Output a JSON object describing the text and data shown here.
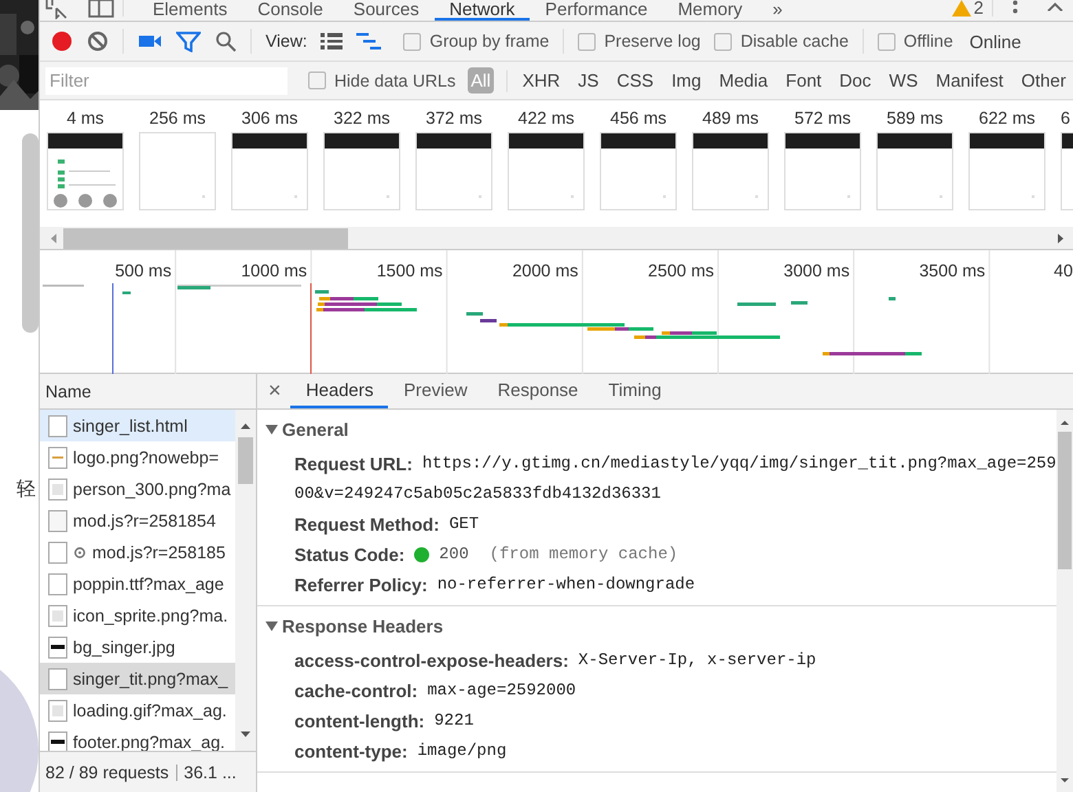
{
  "page_behind": {
    "side_text": "轻"
  },
  "tab_bar": {
    "tabs": [
      {
        "label": "Elements",
        "selected": false
      },
      {
        "label": "Console",
        "selected": false
      },
      {
        "label": "Sources",
        "selected": false
      },
      {
        "label": "Network",
        "selected": true
      },
      {
        "label": "Performance",
        "selected": false
      },
      {
        "label": "Memory",
        "selected": false
      }
    ],
    "more": "»",
    "warnings": "2"
  },
  "toolbar": {
    "recording": true,
    "view_label": "View:",
    "large_rows": false,
    "overview": true,
    "checkboxes": [
      {
        "label": "Group by frame",
        "checked": false
      },
      {
        "label": "Preserve log",
        "checked": false
      },
      {
        "label": "Disable cache",
        "checked": false
      },
      {
        "label": "Offline",
        "checked": false
      }
    ],
    "throttling": "Online"
  },
  "filter_bar": {
    "placeholder": "Filter",
    "hide_data_urls": {
      "label": "Hide data URLs",
      "checked": false
    },
    "types": [
      {
        "label": "All",
        "selected": true
      },
      {
        "label": "XHR",
        "selected": false
      },
      {
        "label": "JS",
        "selected": false
      },
      {
        "label": "CSS",
        "selected": false
      },
      {
        "label": "Img",
        "selected": false
      },
      {
        "label": "Media",
        "selected": false
      },
      {
        "label": "Font",
        "selected": false
      },
      {
        "label": "Doc",
        "selected": false
      },
      {
        "label": "WS",
        "selected": false
      },
      {
        "label": "Manifest",
        "selected": false
      },
      {
        "label": "Other",
        "selected": false
      }
    ]
  },
  "filmstrip": {
    "frames": [
      {
        "time": "4 ms",
        "kind": "loaded"
      },
      {
        "time": "256 ms",
        "kind": "blank"
      },
      {
        "time": "306 ms",
        "kind": "header"
      },
      {
        "time": "322 ms",
        "kind": "header"
      },
      {
        "time": "372 ms",
        "kind": "header"
      },
      {
        "time": "422 ms",
        "kind": "header"
      },
      {
        "time": "456 ms",
        "kind": "header"
      },
      {
        "time": "489 ms",
        "kind": "header"
      },
      {
        "time": "572 ms",
        "kind": "header"
      },
      {
        "time": "589 ms",
        "kind": "header"
      },
      {
        "time": "622 ms",
        "kind": "header"
      },
      {
        "time": "6",
        "kind": "header"
      }
    ]
  },
  "overview": {
    "ticks": [
      "500 ms",
      "1000 ms",
      "1500 ms",
      "2000 ms",
      "2500 ms",
      "3000 ms",
      "3500 ms",
      "40"
    ]
  },
  "requests": {
    "column": "Name",
    "rows": [
      {
        "name": "singer_list.html",
        "kind": "document",
        "gear": false,
        "selected": false,
        "hovered": true
      },
      {
        "name": "logo.png?nowebp=",
        "kind": "logo",
        "gear": false,
        "selected": false,
        "hovered": false
      },
      {
        "name": "person_300.png?ma",
        "gear": false,
        "selected": false,
        "hovered": false
      },
      {
        "name": "mod.js?r=2581854",
        "kind": "script",
        "gear": false,
        "selected": false,
        "hovered": false
      },
      {
        "name": "mod.js?r=258185",
        "kind": "document",
        "gear": true,
        "selected": false,
        "hovered": false
      },
      {
        "name": "poppin.ttf?max_age",
        "kind": "document",
        "gear": false,
        "selected": false,
        "hovered": false
      },
      {
        "name": "icon_sprite.png?ma.",
        "gear": false,
        "selected": false,
        "hovered": false
      },
      {
        "name": "bg_singer.jpg",
        "gear": false,
        "selected": false,
        "hovered": false
      },
      {
        "name": "singer_tit.png?max_",
        "kind": "document",
        "gear": false,
        "selected": true,
        "hovered": false
      },
      {
        "name": "loading.gif?max_ag.",
        "gear": false,
        "selected": false,
        "hovered": false
      },
      {
        "name": "footer.png?max_ag.",
        "gear": false,
        "selected": false,
        "hovered": false
      }
    ],
    "summary": "82 / 89 requests",
    "transferred": "36.1 ..."
  },
  "details": {
    "close": "×",
    "tabs": [
      {
        "label": "Headers",
        "selected": true
      },
      {
        "label": "Preview",
        "selected": false
      },
      {
        "label": "Response",
        "selected": false
      },
      {
        "label": "Timing",
        "selected": false
      }
    ],
    "sections": [
      {
        "title": "General",
        "expanded": true,
        "rows": [
          {
            "key": "Request URL:",
            "value": "https://y.gtimg.cn/mediastyle/yqq/img/singer_tit.png?max_age=259",
            "continuation": "00&v=249247c5ab05c2a5833fdb4132d36331"
          },
          {
            "key": "Request Method:",
            "value": "GET"
          },
          {
            "key": "Status Code:",
            "value": "200",
            "color": "#20b030",
            "note": "(from memory cache)"
          },
          {
            "key": "Referrer Policy:",
            "value": "no-referrer-when-downgrade"
          }
        ]
      },
      {
        "title": "Response Headers",
        "expanded": true,
        "rows": [
          {
            "key": "access-control-expose-headers:",
            "value": "X-Server-Ip, x-server-ip"
          },
          {
            "key": "cache-control:",
            "value": "max-age=2592000"
          },
          {
            "key": "content-length:",
            "value": "9221"
          },
          {
            "key": "content-type:",
            "value": "image/png"
          }
        ]
      }
    ]
  }
}
